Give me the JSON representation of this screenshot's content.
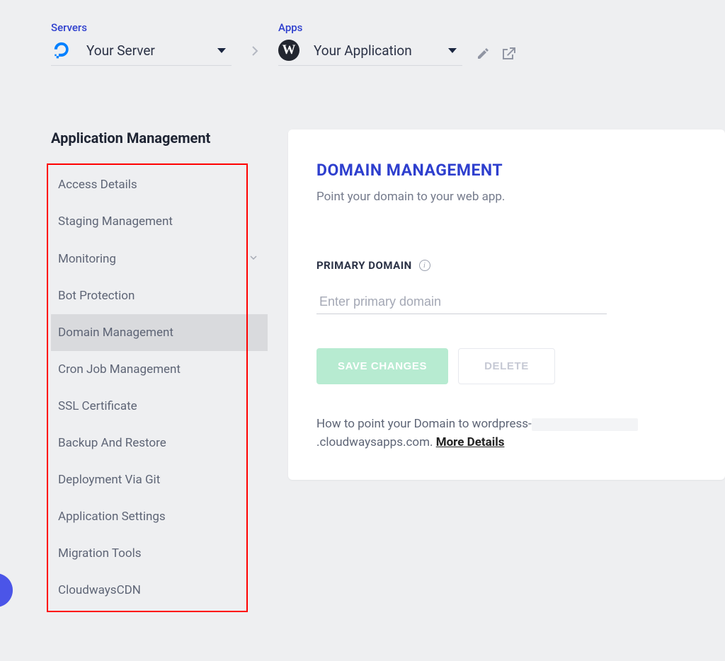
{
  "breadcrumb": {
    "servers_label": "Servers",
    "server_name": "Your Server",
    "apps_label": "Apps",
    "app_name": "Your Application"
  },
  "sidebar": {
    "title": "Application Management",
    "items": [
      {
        "label": "Access Details"
      },
      {
        "label": "Staging Management"
      },
      {
        "label": "Monitoring",
        "has_chevron": true
      },
      {
        "label": "Bot Protection"
      },
      {
        "label": "Domain Management",
        "active": true
      },
      {
        "label": "Cron Job Management"
      },
      {
        "label": "SSL Certificate"
      },
      {
        "label": "Backup And Restore"
      },
      {
        "label": "Deployment Via Git"
      },
      {
        "label": "Application Settings"
      },
      {
        "label": "Migration Tools"
      },
      {
        "label": "CloudwaysCDN"
      }
    ]
  },
  "panel": {
    "title": "DOMAIN MANAGEMENT",
    "subtitle": "Point your domain to your web app.",
    "section_label": "PRIMARY DOMAIN",
    "input_placeholder": "Enter primary domain",
    "save_btn": "SAVE CHANGES",
    "delete_btn": "DELETE",
    "help_prefix": "How to point your Domain to wordpress-",
    "help_suffix": ".cloudwaysapps.com.  ",
    "help_link": "More Details"
  }
}
